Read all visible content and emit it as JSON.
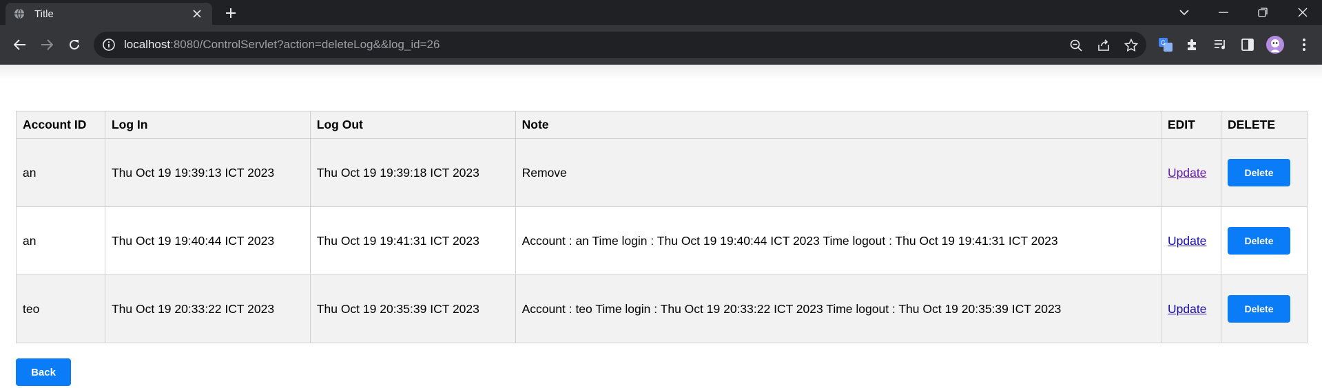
{
  "browser": {
    "tab_title": "Title",
    "url_host": "localhost",
    "url_rest": ":8080/ControlServlet?action=deleteLog&&log_id=26"
  },
  "table": {
    "headers": [
      "Account ID",
      "Log In",
      "Log Out",
      "Note",
      "EDIT",
      "DELETE"
    ],
    "rows": [
      {
        "account_id": "an",
        "log_in": "Thu Oct 19 19:39:13 ICT 2023",
        "log_out": "Thu Oct 19 19:39:18 ICT 2023",
        "note": "Remove",
        "edit_label": "Update",
        "delete_label": "Delete"
      },
      {
        "account_id": "an",
        "log_in": "Thu Oct 19 19:40:44 ICT 2023",
        "log_out": "Thu Oct 19 19:41:31 ICT 2023",
        "note": "Account : an Time login : Thu Oct 19 19:40:44 ICT 2023 Time logout : Thu Oct 19 19:41:31 ICT 2023",
        "edit_label": "Update",
        "delete_label": "Delete"
      },
      {
        "account_id": "teo",
        "log_in": "Thu Oct 19 20:33:22 ICT 2023",
        "log_out": "Thu Oct 19 20:35:39 ICT 2023",
        "note": "Account : teo Time login : Thu Oct 19 20:33:22 ICT 2023 Time logout : Thu Oct 19 20:35:39 ICT 2023",
        "edit_label": "Update",
        "delete_label": "Delete"
      }
    ]
  },
  "back_label": "Back",
  "colors": {
    "button_blue": "#0a7cf8",
    "link": "#1a0dab",
    "link_visited": "#681da8",
    "row_shade": "#f2f2f2"
  }
}
